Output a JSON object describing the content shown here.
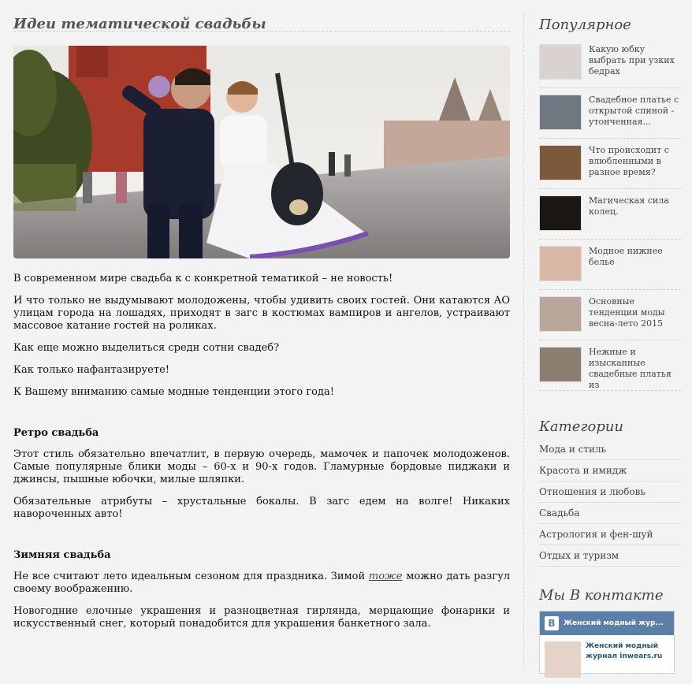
{
  "post": {
    "title": "Идеи тематической свадьбы"
  },
  "article": {
    "intro": [
      "В современном мире свадьба к с конкретной тематикой – не новость!",
      "И что только не выдумывают молодожены, чтобы удивить своих гостей. Они катаются АО улицам города на лошадях, приходят в загс в костюмах вампиров и ангелов, устраивают массовое катание гостей на роликах.",
      "Как еще можно выделиться среди сотни свадеб?",
      "Как только нафантазируете!",
      "К Вашему вниманию самые модные тенденции этого года!"
    ],
    "retro": {
      "heading": "Ретро свадьба",
      "p1": "Этот стиль обязательно впечатлит, в первую очередь, мамочек и папочек молодоженов. Самые популярные блики моды – 60-х и 90-х годов. Гламурные бордовые пиджаки и джинсы, пышные юбочки, милые шляпки.",
      "p2": "Обязательные атрибуты – хрустальные бокалы. В загс едем на волге! Никаких навороченных авто!"
    },
    "winter": {
      "heading": "Зимняя свадьба",
      "p1_before": "Не все считают лето идеальным сезоном для праздника. Зимой ",
      "p1_link": "тоже",
      "p1_after": " можно дать разгул своему воображению.",
      "p2": "Новогодние елочные украшения и разноцветная гирлянда, мерцающие фонарики и искусственный снег, который понадобится для украшения банкетного зала."
    }
  },
  "sidebar": {
    "popular_title": "Популярное",
    "popular": [
      {
        "label": "Какую юбку выбрать при узких бедрах",
        "thumb": "#d9d2cf"
      },
      {
        "label": "Свадебное платье с открытой спиной - утонченная...",
        "thumb": "#6f7780"
      },
      {
        "label": "Что происходит с влюбленными в разное время?",
        "thumb": "#7a5a3a"
      },
      {
        "label": "Магическая сила колец.",
        "thumb": "#1b1712"
      },
      {
        "label": "Модное нижнее белье",
        "thumb": "#d9b7a6"
      },
      {
        "label": "Основные тенденции моды весна-лето 2015",
        "thumb": "#b8a79a"
      },
      {
        "label": "Нежные и изысканные свадебные платья из",
        "thumb": "#8c7e70"
      }
    ],
    "categories_title": "Категории",
    "categories": [
      "Мода и стиль",
      "Красота и имидж",
      "Отношения и любовь",
      "Свадьба",
      "Астрология и фен-шуй",
      "Отдых и туризм"
    ],
    "vk_title": "Мы В контакте",
    "vk": {
      "logo": "B",
      "header": "Женский модный жур...",
      "name": "Женский модный журнал inwears.ru"
    }
  }
}
